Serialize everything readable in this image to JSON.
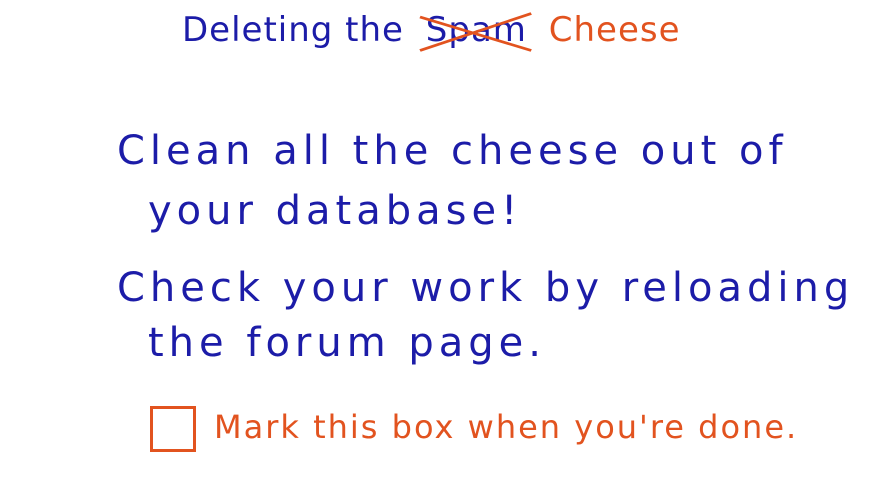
{
  "title": {
    "prefix": "Deleting the",
    "struck_word": "Spam",
    "replacement": "Cheese"
  },
  "instructions": [
    "Clean all the cheese out of",
    "your database!",
    "Check your work by reloading",
    "the forum page."
  ],
  "checkbox": {
    "label": "Mark this box when you're done.",
    "checked": false
  },
  "colors": {
    "ink_blue": "#1c1ca8",
    "ink_orange": "#e2531f"
  }
}
